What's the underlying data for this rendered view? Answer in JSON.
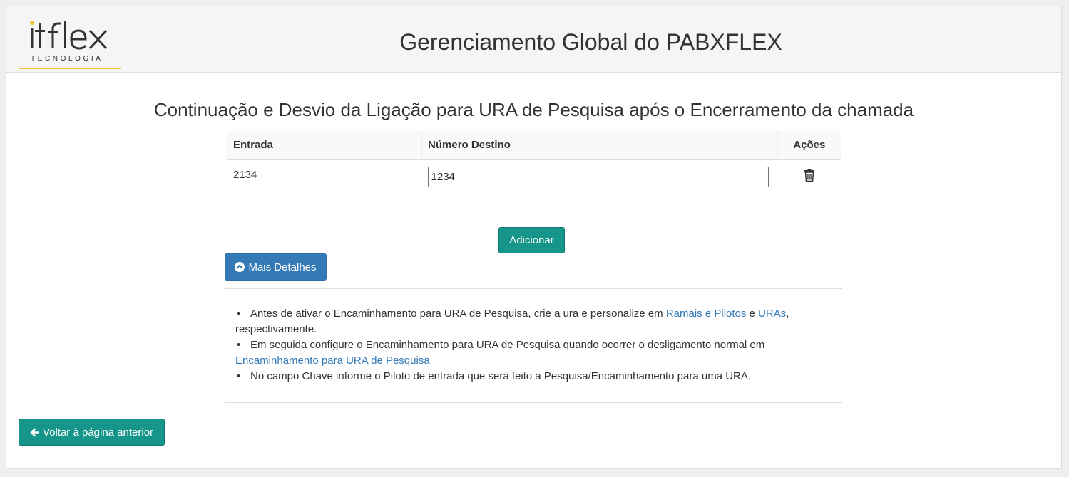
{
  "logo": {
    "brand": "itflex",
    "tagline": "TECNOLOGIA",
    "accent_color": "#f4c430"
  },
  "header": {
    "title": "Gerenciamento Global do PABXFLEX"
  },
  "page": {
    "title": "Continuação e Desvio da Ligação para URA de Pesquisa após o Encerramento da chamada"
  },
  "table": {
    "columns": [
      "Entrada",
      "Número Destino",
      "Ações"
    ],
    "rows": [
      {
        "entrada": "2134",
        "numero_destino": "1234",
        "action_icon": "trash-icon"
      }
    ]
  },
  "buttons": {
    "add_label": "Adicionar",
    "details_label": "Mais Detalhes",
    "details_icon": "chevron-up-circle-icon",
    "back_label": "Voltar à página anterior",
    "back_icon": "arrow-left-icon"
  },
  "details": {
    "item1": {
      "text_before": "Antes de ativar o Encaminhamento para URA de Pesquisa, crie a ura e personalize em ",
      "link1": "Ramais e Pilotos",
      "connector": " e ",
      "link2": "URAs",
      "text_after": ", respectivamente."
    },
    "item2": {
      "text_before": "Em seguida configure o Encaminhamento para URA de Pesquisa quando ocorrer o desligamento normal em ",
      "link": "Encaminhamento para URA de Pesquisa"
    },
    "item3": {
      "text": "No campo Chave informe o Piloto de entrada que será feito a Pesquisa/Encaminhamento para uma URA."
    }
  },
  "colors": {
    "primary_teal": "#16958a",
    "primary_blue": "#337ab7",
    "link": "#337ab7"
  }
}
